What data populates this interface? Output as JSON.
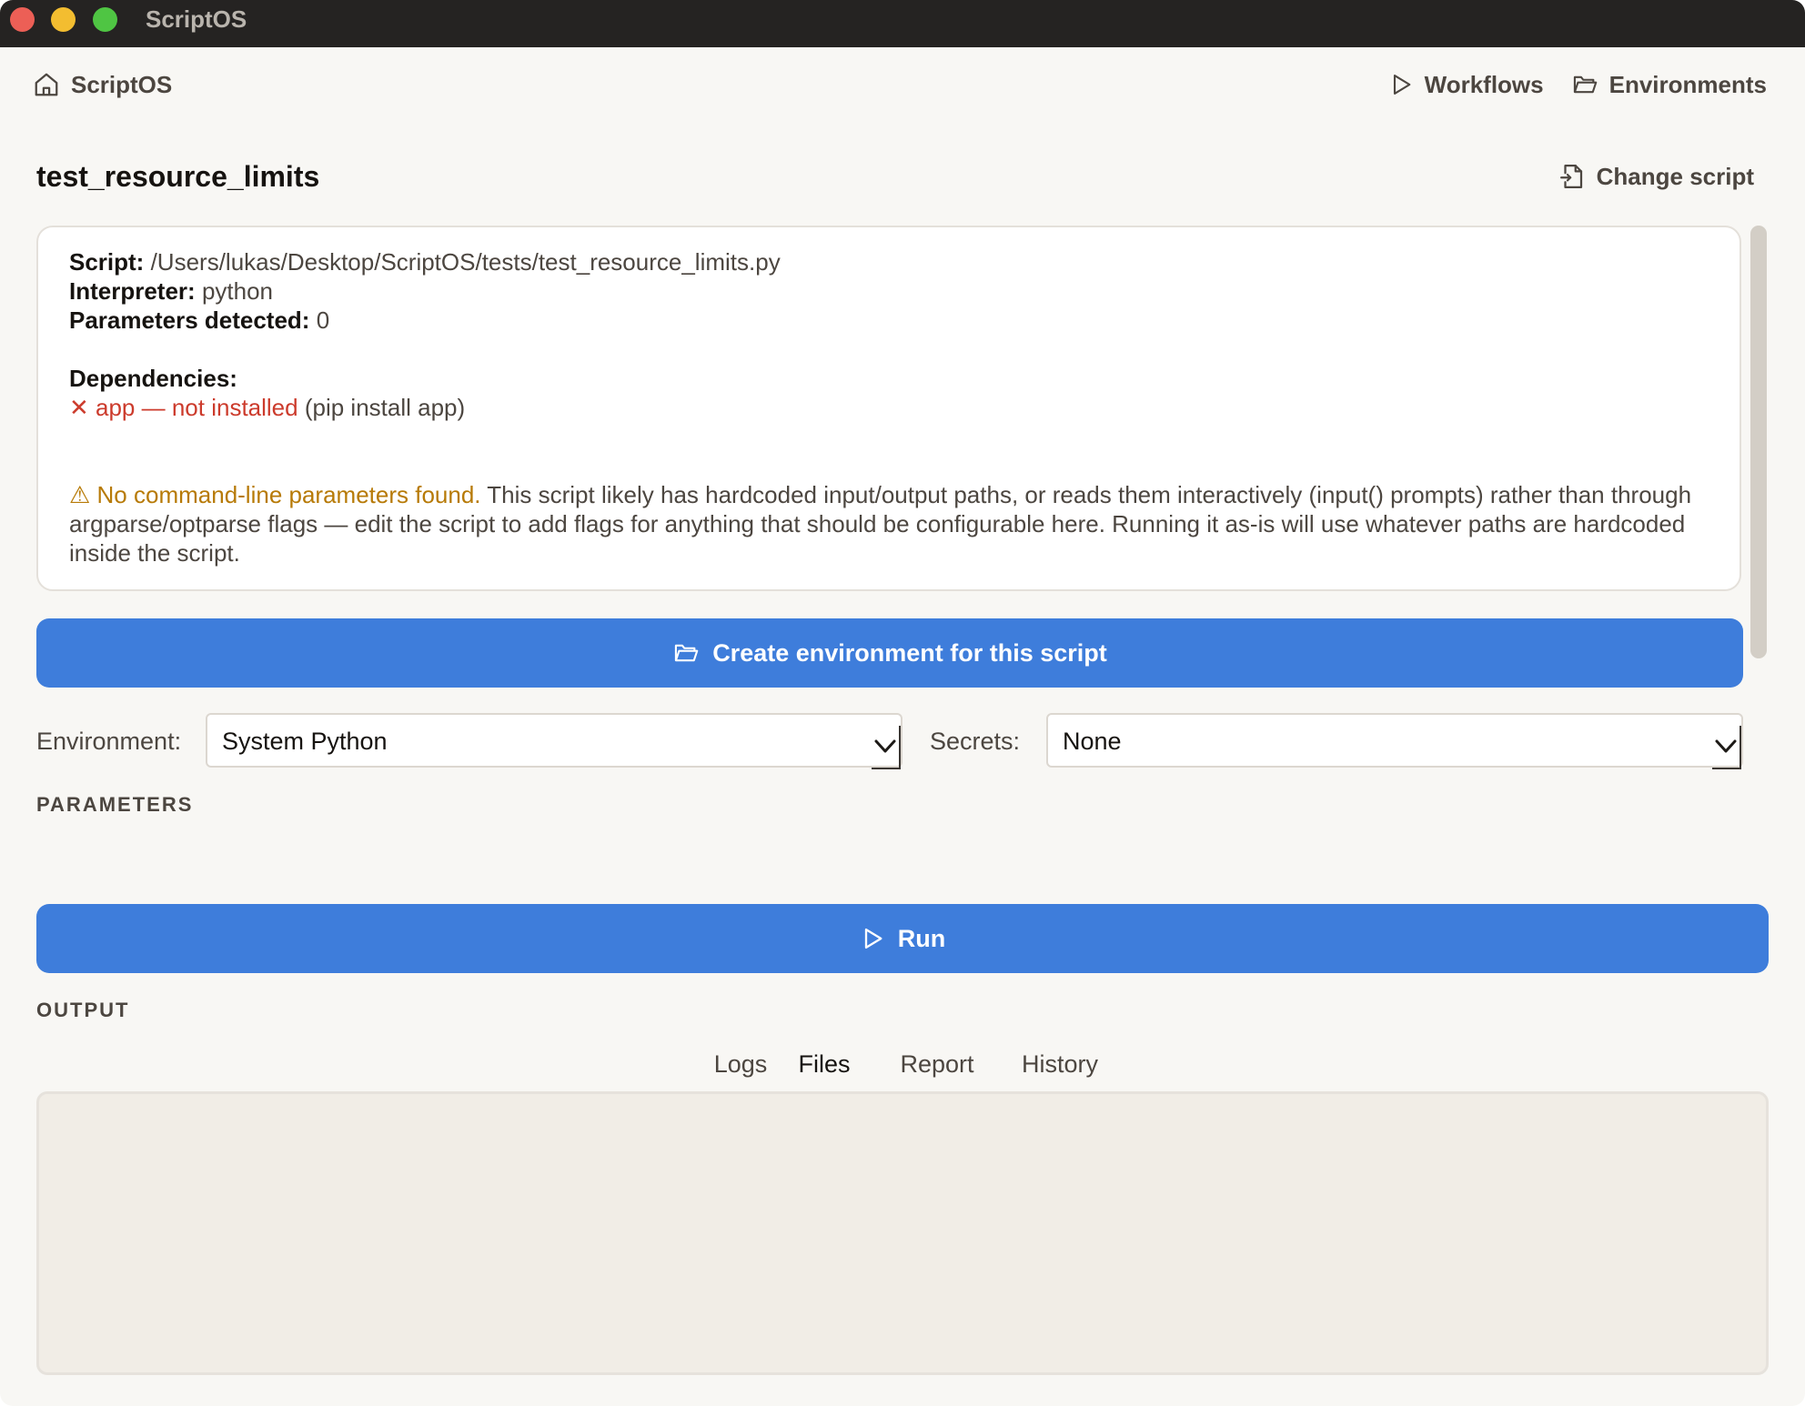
{
  "window": {
    "title": "ScriptOS"
  },
  "nav": {
    "home_label": "ScriptOS",
    "links": [
      {
        "label": "Workflows",
        "icon": "play-icon"
      },
      {
        "label": "Environments",
        "icon": "folder-icon"
      }
    ]
  },
  "header": {
    "title": "test_resource_limits",
    "change_script_label": "Change script"
  },
  "info": {
    "script_label": "Script:",
    "script_path": "/Users/lukas/Desktop/ScriptOS/tests/test_resource_limits.py",
    "interpreter_label": "Interpreter:",
    "interpreter_value": "python",
    "params_label": "Parameters detected:",
    "params_value": "0",
    "deps_label": "Dependencies:",
    "dep_item": "✕ app — not installed",
    "dep_hint": "(pip install app)",
    "warning_lead": "⚠ No command-line parameters found.",
    "warning_text": "This script likely has hardcoded input/output paths, or reads them interactively (input() prompts) rather than through argparse/optparse flags — edit the script to add flags for anything that should be configurable here. Running it as-is will use whatever paths are hardcoded inside the script."
  },
  "create_env_button": "Create environment for this script",
  "environment": {
    "label": "Environment:",
    "selected": "System Python"
  },
  "secrets": {
    "label": "Secrets:",
    "selected": "None"
  },
  "parameters_heading": "PARAMETERS",
  "run_button": "Run",
  "output_heading": "OUTPUT",
  "tabs": [
    {
      "label": "Logs",
      "active": false
    },
    {
      "label": "Files",
      "active": true
    },
    {
      "label": "Report",
      "active": false
    },
    {
      "label": "History",
      "active": false
    }
  ],
  "colors": {
    "accent": "#3e7ddb",
    "error": "#cc3b2c",
    "warning": "#b77a07",
    "background": "#f8f7f4"
  }
}
